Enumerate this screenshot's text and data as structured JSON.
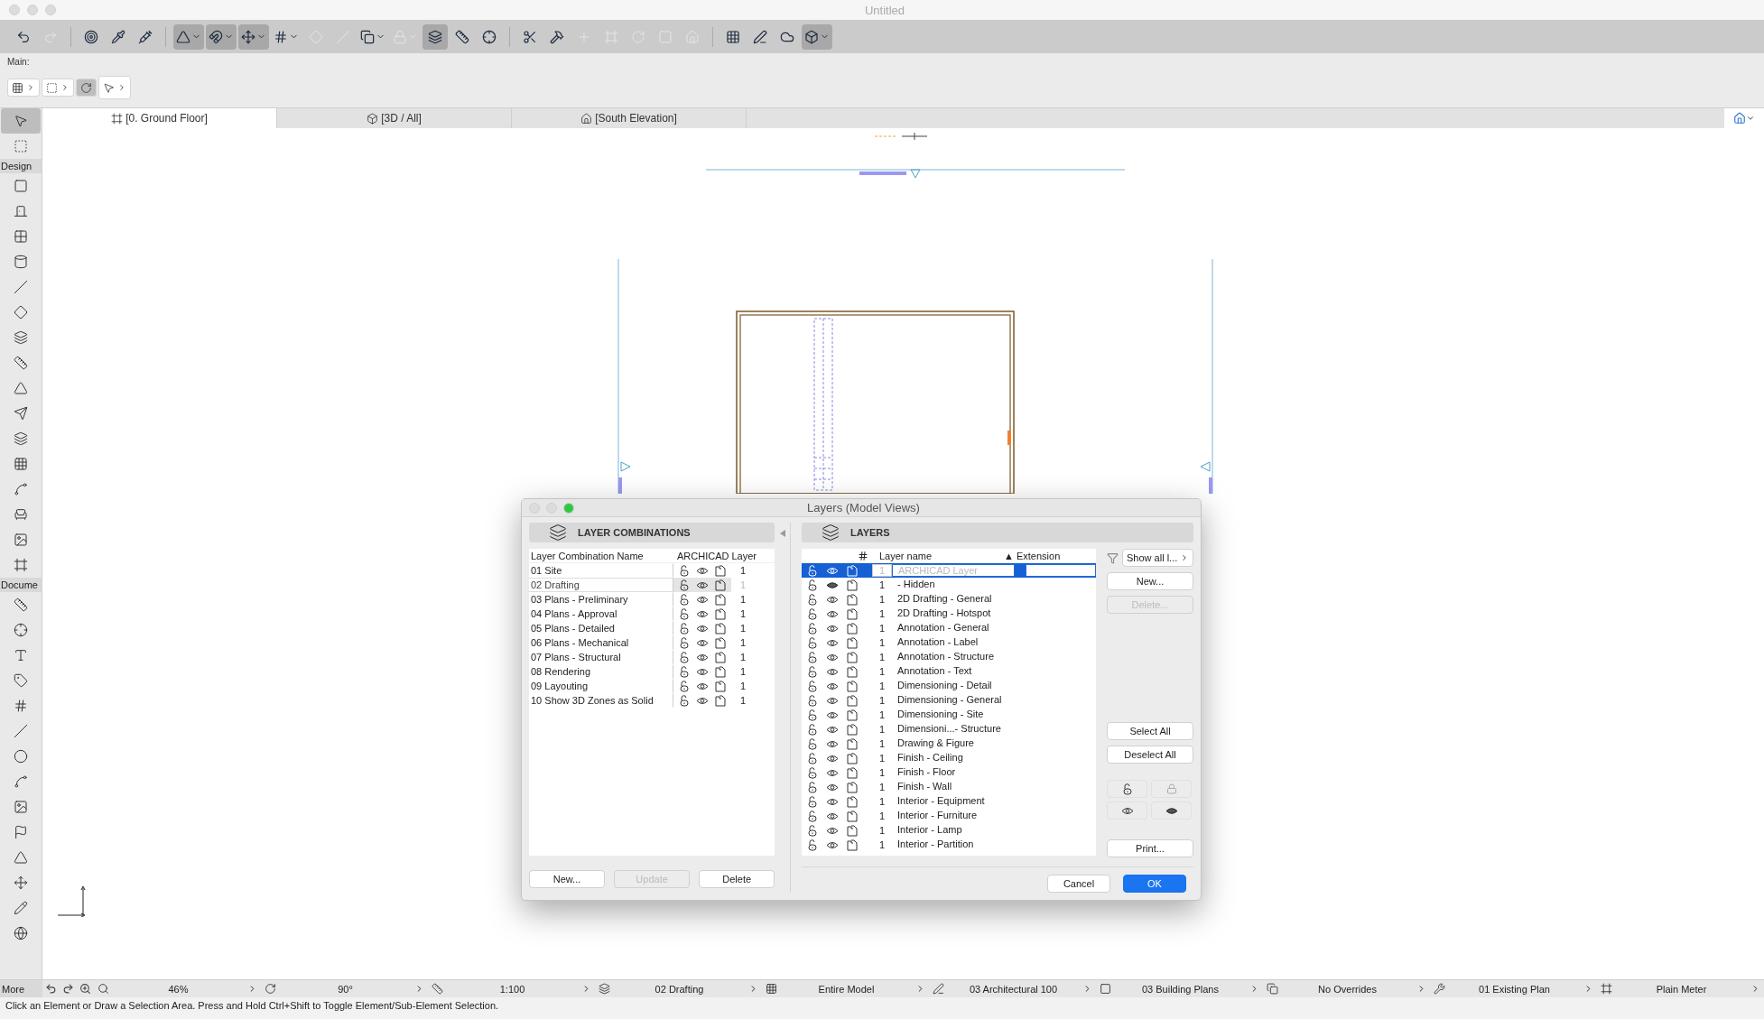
{
  "window": {
    "title": "Untitled"
  },
  "toolbar": {
    "groups": [
      [
        {
          "pressed": false,
          "disabled": false,
          "dropdown": false
        },
        {
          "pressed": false,
          "disabled": true,
          "dropdown": false
        }
      ],
      [
        {
          "pressed": false,
          "disabled": false,
          "dropdown": false
        },
        {
          "pressed": false,
          "disabled": false,
          "dropdown": false
        },
        {
          "pressed": false,
          "disabled": false,
          "dropdown": false
        }
      ],
      [
        {
          "pressed": true,
          "disabled": false,
          "dropdown": true
        },
        {
          "pressed": true,
          "disabled": false,
          "dropdown": true
        },
        {
          "pressed": true,
          "disabled": false,
          "dropdown": true
        },
        {
          "pressed": false,
          "disabled": false,
          "dropdown": true
        },
        {
          "pressed": false,
          "disabled": true,
          "dropdown": false
        },
        {
          "pressed": false,
          "disabled": true,
          "dropdown": false
        },
        {
          "pressed": false,
          "disabled": false,
          "dropdown": true
        },
        {
          "pressed": false,
          "disabled": true,
          "dropdown": true
        },
        {
          "pressed": true,
          "disabled": false,
          "dropdown": false
        },
        {
          "pressed": false,
          "disabled": false,
          "dropdown": false
        },
        {
          "pressed": false,
          "disabled": false,
          "dropdown": false
        }
      ],
      [
        {
          "pressed": false,
          "disabled": false,
          "dropdown": false
        },
        {
          "pressed": false,
          "disabled": false,
          "dropdown": false
        },
        {
          "pressed": false,
          "disabled": true,
          "dropdown": false
        },
        {
          "pressed": false,
          "disabled": true,
          "dropdown": false
        },
        {
          "pressed": false,
          "disabled": true,
          "dropdown": false
        },
        {
          "pressed": false,
          "disabled": true,
          "dropdown": false
        },
        {
          "pressed": false,
          "disabled": true,
          "dropdown": false
        }
      ],
      [
        {
          "pressed": false,
          "disabled": false,
          "dropdown": false
        },
        {
          "pressed": false,
          "disabled": false,
          "dropdown": false
        },
        {
          "pressed": false,
          "disabled": false,
          "dropdown": false
        },
        {
          "pressed": true,
          "disabled": false,
          "dropdown": true
        }
      ]
    ]
  },
  "main_bar": {
    "label": "Main:",
    "controls": [
      {
        "pressed": false
      },
      {
        "pressed": false
      },
      {
        "pressed": true
      },
      {
        "pressed": false
      }
    ]
  },
  "view_tabs": [
    {
      "label": "[0. Ground Floor]",
      "selected": true
    },
    {
      "label": "[3D / All]",
      "selected": false
    },
    {
      "label": "[South Elevation]",
      "selected": false
    }
  ],
  "toolbox": {
    "top_tools": [
      {
        "selected": true
      },
      {
        "selected": false
      }
    ],
    "sections": [
      {
        "label": "Design",
        "tools": [
          {
            "selected": false
          },
          {
            "selected": false
          },
          {
            "selected": false
          },
          {
            "selected": false
          },
          {
            "selected": false
          },
          {
            "selected": false
          },
          {
            "selected": false
          },
          {
            "selected": false
          },
          {
            "selected": false
          },
          {
            "selected": false
          },
          {
            "selected": false
          },
          {
            "selected": false
          },
          {
            "selected": false
          },
          {
            "selected": false
          },
          {
            "selected": false
          },
          {
            "selected": false
          }
        ]
      },
      {
        "label": "Docume",
        "tools": [
          {
            "selected": false
          },
          {
            "selected": false
          },
          {
            "selected": false
          },
          {
            "selected": false
          },
          {
            "selected": false
          },
          {
            "selected": false
          },
          {
            "selected": false
          },
          {
            "selected": false
          },
          {
            "selected": false
          },
          {
            "selected": false
          },
          {
            "selected": false
          },
          {
            "selected": false
          },
          {
            "selected": false
          },
          {
            "selected": false
          }
        ]
      }
    ]
  },
  "dialog": {
    "title": "Layers (Model Views)",
    "combinations": {
      "heading": "LAYER COMBINATIONS",
      "columns": [
        "Layer Combination Name",
        "ARCHICAD Layer"
      ],
      "rows": [
        {
          "name": "01 Site",
          "number": "1",
          "selected": false
        },
        {
          "name": "02 Drafting",
          "number": "1",
          "selected": true
        },
        {
          "name": "03 Plans - Preliminary",
          "number": "1",
          "selected": false
        },
        {
          "name": "04 Plans - Approval",
          "number": "1",
          "selected": false
        },
        {
          "name": "05 Plans - Detailed",
          "number": "1",
          "selected": false
        },
        {
          "name": "06 Plans - Mechanical",
          "number": "1",
          "selected": false
        },
        {
          "name": "07 Plans - Structural",
          "number": "1",
          "selected": false
        },
        {
          "name": "08 Rendering",
          "number": "1",
          "selected": false
        },
        {
          "name": "09 Layouting",
          "number": "1",
          "selected": false
        },
        {
          "name": "10 Show 3D Zones as Solid",
          "number": "1",
          "selected": false
        }
      ],
      "buttons": [
        {
          "label": "New...",
          "disabled": false
        },
        {
          "label": "Update",
          "disabled": true
        },
        {
          "label": "Delete",
          "disabled": false
        }
      ]
    },
    "layers": {
      "heading": "LAYERS",
      "columns": [
        "Layer name",
        "Extension"
      ],
      "sort_mark": "▲",
      "rows": [
        {
          "number": "1",
          "name": "ARCHICAD Layer",
          "selected": true,
          "visible": true
        },
        {
          "number": "1",
          "name": "- Hidden",
          "selected": false,
          "visible": false
        },
        {
          "number": "1",
          "name": "2D Drafting - General",
          "selected": false,
          "visible": true
        },
        {
          "number": "1",
          "name": "2D Drafting - Hotspot",
          "selected": false,
          "visible": true
        },
        {
          "number": "1",
          "name": "Annotation - General",
          "selected": false,
          "visible": true
        },
        {
          "number": "1",
          "name": "Annotation - Label",
          "selected": false,
          "visible": true
        },
        {
          "number": "1",
          "name": "Annotation - Structure",
          "selected": false,
          "visible": true
        },
        {
          "number": "1",
          "name": "Annotation - Text",
          "selected": false,
          "visible": true
        },
        {
          "number": "1",
          "name": "Dimensioning - Detail",
          "selected": false,
          "visible": true
        },
        {
          "number": "1",
          "name": "Dimensioning - General",
          "selected": false,
          "visible": true
        },
        {
          "number": "1",
          "name": "Dimensioning - Site",
          "selected": false,
          "visible": true
        },
        {
          "number": "1",
          "name": "Dimensioni...- Structure",
          "selected": false,
          "visible": true
        },
        {
          "number": "1",
          "name": "Drawing & Figure",
          "selected": false,
          "visible": true
        },
        {
          "number": "1",
          "name": "Finish - Ceiling",
          "selected": false,
          "visible": true
        },
        {
          "number": "1",
          "name": "Finish - Floor",
          "selected": false,
          "visible": true
        },
        {
          "number": "1",
          "name": "Finish - Wall",
          "selected": false,
          "visible": true
        },
        {
          "number": "1",
          "name": "Interior - Equipment",
          "selected": false,
          "visible": true
        },
        {
          "number": "1",
          "name": "Interior - Furniture",
          "selected": false,
          "visible": true
        },
        {
          "number": "1",
          "name": "Interior - Lamp",
          "selected": false,
          "visible": true
        },
        {
          "number": "1",
          "name": "Interior - Partition",
          "selected": false,
          "visible": true
        }
      ],
      "filter": "Show all l...",
      "buttons": [
        {
          "label": "New...",
          "disabled": false
        },
        {
          "label": "Delete...",
          "disabled": true
        }
      ],
      "select_buttons": [
        {
          "label": "Select All",
          "disabled": false
        },
        {
          "label": "Deselect All",
          "disabled": false
        }
      ],
      "print_button": {
        "label": "Print...",
        "disabled": false
      },
      "footer": [
        {
          "label": "Cancel",
          "default": false
        },
        {
          "label": "OK",
          "default": true
        }
      ]
    }
  },
  "status_bar": {
    "more_label": "More",
    "items": [
      "46%",
      "90°",
      "1:100",
      "02 Drafting",
      "Entire Model",
      "03 Architectural 100",
      "03 Building Plans",
      "No Overrides",
      "01 Existing Plan",
      "Plain Meter"
    ],
    "message": "Click an Element or Draw a Selection Area. Press and Hold Ctrl+Shift to Toggle Element/Sub-Element Selection."
  }
}
